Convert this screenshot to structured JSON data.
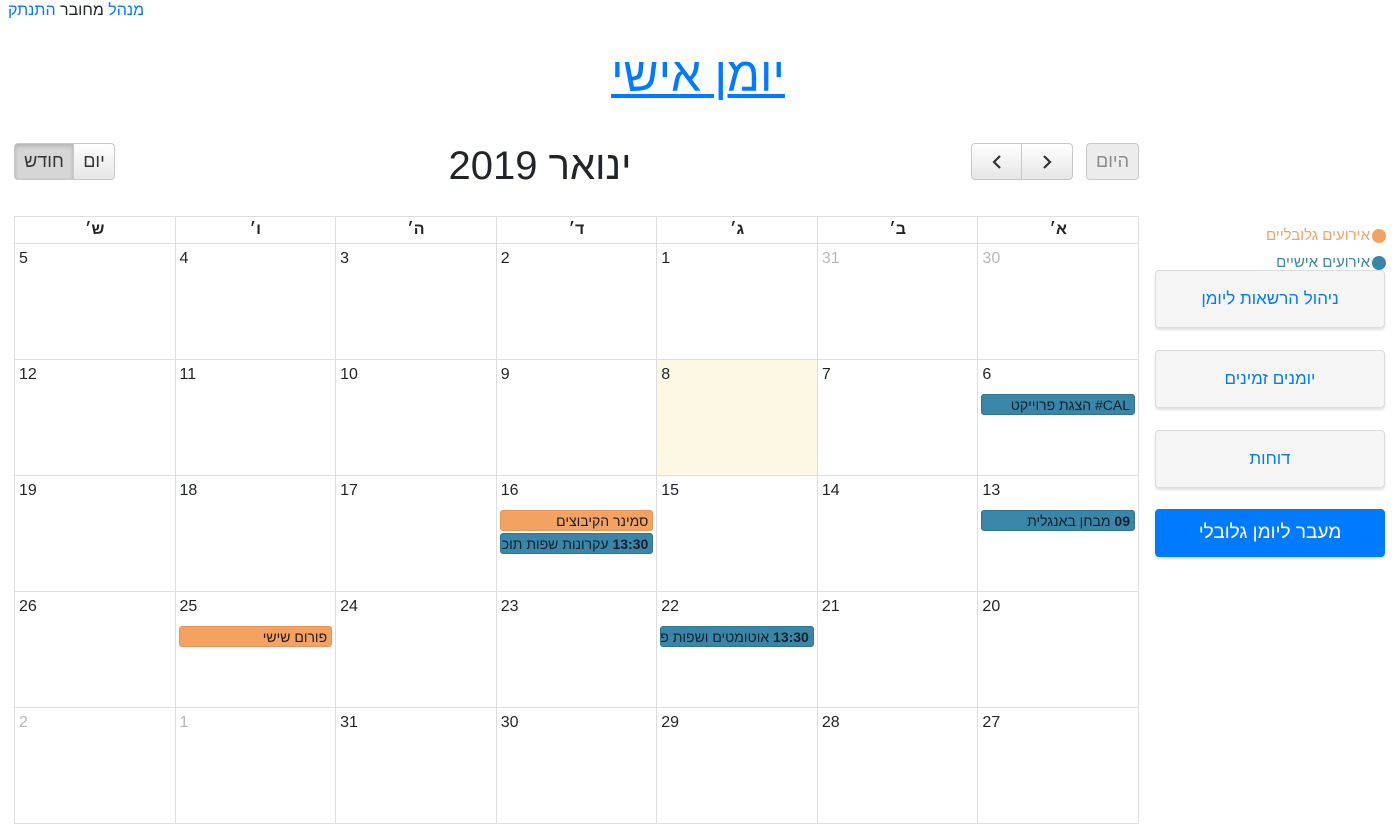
{
  "topbar": {
    "admin": "מנהל",
    "connected": "מחובר",
    "logout": "התנתק"
  },
  "title": "יומן אישי",
  "toolbar": {
    "today": "היום",
    "month_title": "ינואר 2019",
    "view_month": "חודש",
    "view_day": "יום"
  },
  "weekdays": [
    "א׳",
    "ב׳",
    "ג׳",
    "ד׳",
    "ה׳",
    "ו׳",
    "ש׳"
  ],
  "weeks": [
    [
      {
        "n": "30",
        "other": true
      },
      {
        "n": "31",
        "other": true
      },
      {
        "n": "1"
      },
      {
        "n": "2"
      },
      {
        "n": "3"
      },
      {
        "n": "4"
      },
      {
        "n": "5"
      }
    ],
    [
      {
        "n": "6"
      },
      {
        "n": "7"
      },
      {
        "n": "8",
        "today": true
      },
      {
        "n": "9"
      },
      {
        "n": "10"
      },
      {
        "n": "11"
      },
      {
        "n": "12"
      }
    ],
    [
      {
        "n": "13"
      },
      {
        "n": "14"
      },
      {
        "n": "15"
      },
      {
        "n": "16"
      },
      {
        "n": "17"
      },
      {
        "n": "18"
      },
      {
        "n": "19"
      }
    ],
    [
      {
        "n": "20"
      },
      {
        "n": "21"
      },
      {
        "n": "22"
      },
      {
        "n": "23"
      },
      {
        "n": "24"
      },
      {
        "n": "25"
      },
      {
        "n": "26"
      }
    ],
    [
      {
        "n": "27"
      },
      {
        "n": "28"
      },
      {
        "n": "29"
      },
      {
        "n": "30"
      },
      {
        "n": "31"
      },
      {
        "n": "1",
        "other": true
      },
      {
        "n": "2",
        "other": true
      }
    ]
  ],
  "events": {
    "ev1": {
      "time": "",
      "title": "CAL# הצגת פרוייקט",
      "kind": "personal"
    },
    "ev2": {
      "time": "09",
      "title": "מבחן באנגלית",
      "kind": "personal"
    },
    "ev3": {
      "time": "",
      "title": "סמינר הקיבוצים",
      "kind": "global"
    },
    "ev4": {
      "time": "13:30",
      "title": "עקרונות שפות תוכנה",
      "kind": "personal"
    },
    "ev5": {
      "time": "13:30",
      "title": "אוטומטים ושפות פורמליות",
      "kind": "personal"
    },
    "ev6": {
      "time": "",
      "title": "פורום שישי",
      "kind": "global"
    }
  },
  "legend": {
    "global": "אירועים גלובליים",
    "personal": "אירועים אישיים"
  },
  "colors": {
    "global": "#f4a261",
    "personal": "#3a86a8",
    "accent": "#007bff",
    "today_bg": "#fcf8e3"
  },
  "sidebar": {
    "permissions": "ניהול הרשאות ליומן",
    "available": "יומנים זמינים",
    "reports": "דוחות",
    "global_switch": "מעבר ליומן גלובלי"
  }
}
